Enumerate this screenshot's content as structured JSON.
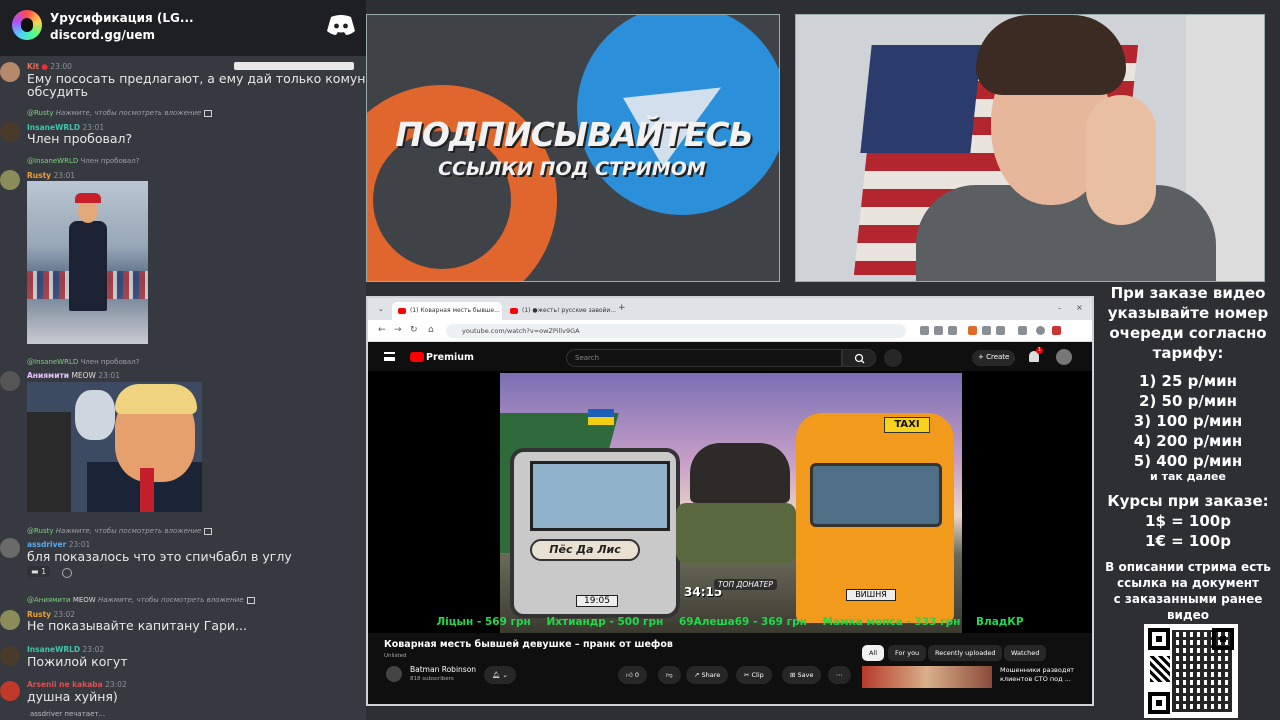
{
  "chat": {
    "server_name": "Урусификация (LG...",
    "server_invite": "discord.gg/uem",
    "typing": "assdriver печатает...",
    "messages": [
      {
        "nick": "Kit",
        "time": "23:00",
        "text": "Ему пососать предлагают, а ему дай только комуналку",
        "text2": "обсудить"
      },
      {
        "reply_nick": "@Rusty",
        "reply_text": "Нажмите, чтобы посмотреть вложение",
        "nick": "InsaneWRLD",
        "time": "23:01",
        "text": "Член пробовал?"
      },
      {
        "reply_nick": "@InsaneWRLD",
        "reply_text": "Член пробовал?",
        "nick": "Rusty",
        "time": "23:01"
      },
      {
        "reply_nick": "@InsaneWRLD",
        "reply_text": "Член пробовал?",
        "nick": "Аниямити",
        "tag": "MEOW",
        "time": "23:01"
      },
      {
        "reply_nick": "@Rusty",
        "reply_text": "Нажмите, чтобы посмотреть вложение",
        "nick": "assdriver",
        "time": "23:01",
        "text": "бля показалось что это спичбабл в углу",
        "reaction_count": "1"
      },
      {
        "reply_nick": "@Аниямити",
        "reply_tag": "MEOW",
        "reply_text": "Нажмите, чтобы посмотреть вложение",
        "nick": "Rusty",
        "time": "23:02",
        "text": "Не показывайте капитану Гари..."
      },
      {
        "nick": "InsaneWRLD",
        "time": "23:02",
        "text": "Пожилой когут"
      },
      {
        "nick": "Arsenii ne kakaba",
        "time": "23:02",
        "text": "душна хуйня)"
      }
    ]
  },
  "banner": {
    "line1": "ПОДПИСЫВАЙТЕСЬ",
    "line2": "ССЫЛКИ ПОД СТРИМОМ"
  },
  "browser": {
    "tabs": [
      "(1) Коварная месть бывше...",
      "(1) ●жесть! русские завойи..."
    ],
    "url": "youtube.com/watch?v=owZPillv9GA",
    "yt": {
      "logo": "Premium",
      "search_placeholder": "Search",
      "create": "Create",
      "bell_count": "1"
    },
    "thumbnail": {
      "brand": "Пёс Да Лис",
      "taxi_sign": "TAXI",
      "plate_left": "19:05",
      "plate_right": "ВИШНЯ",
      "timer": "34:15",
      "top_donator": "ТОП ДОНАТЕР"
    },
    "donors": [
      "Ліцын - 569 грн",
      "Ихтиандр - 500 грн",
      "69Алеша69 - 369 грн",
      "Мамка мопса - 333 грн",
      "ВладКР"
    ],
    "video": {
      "title": "Коварная месть бывшей девушке – пранк от шефов",
      "unlisted": "Unlisted",
      "channel": "Batman Robinson",
      "subscribers": "818 subscribers",
      "likes": "0",
      "share": "Share",
      "clip": "Clip",
      "save": "Save"
    },
    "chips": [
      "All",
      "For you",
      "Recently uploaded",
      "Watched"
    ],
    "rec_title": "Мошенники разводят клиентов СТО под ..."
  },
  "info_panel": {
    "lines": [
      "При заказе видео",
      "указывайте номер",
      "очереди согласно",
      "тарифу:",
      "1) 25 р/мин",
      "2) 50 р/мин",
      "3) 100 р/мин",
      "4) 200 р/мин",
      "5) 400 р/мин",
      "и так далее",
      "Курсы при заказе:",
      "1$ = 100р",
      "1€ = 100р",
      "В описании стрима есть",
      "ссылка на документ",
      "с заказанными ранее",
      "видео"
    ]
  }
}
